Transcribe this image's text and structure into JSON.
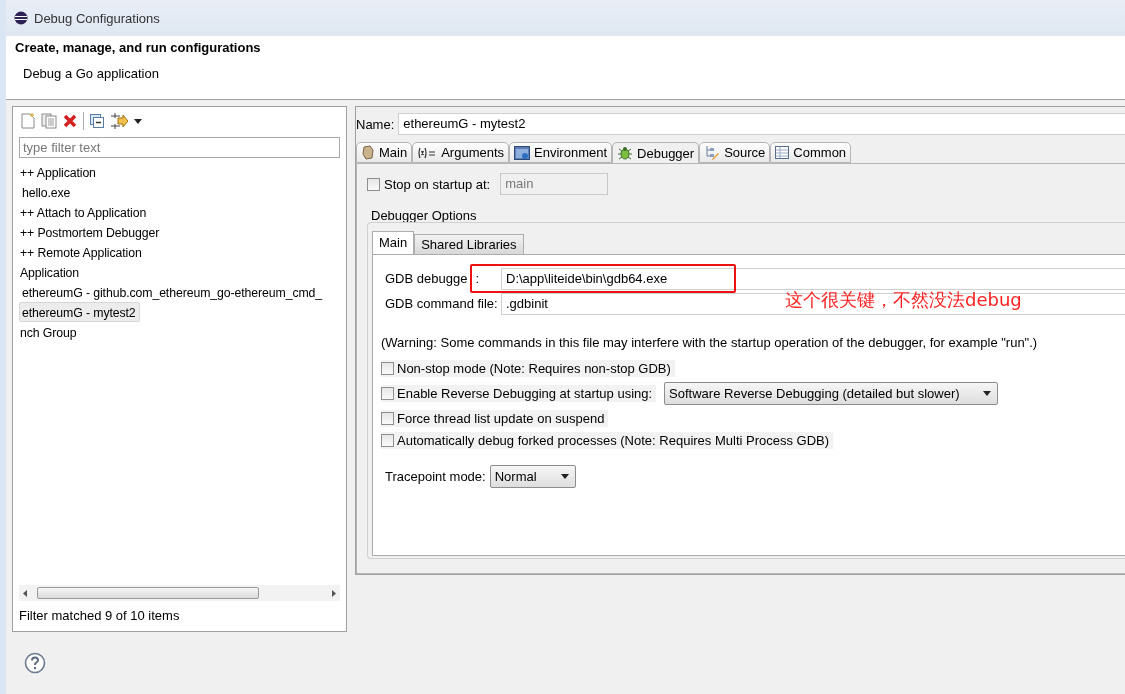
{
  "window": {
    "title": "Debug Configurations"
  },
  "header": {
    "title": "Create, manage, and run configurations",
    "subtitle": "Debug a Go application"
  },
  "filter": {
    "placeholder": "type filter text"
  },
  "tree": [
    {
      "label": "++ Application",
      "selected": false,
      "children": [
        {
          "label": "hello.exe",
          "selected": false
        }
      ]
    },
    {
      "label": "++ Attach to Application",
      "selected": false
    },
    {
      "label": "++ Postmortem Debugger",
      "selected": false
    },
    {
      "label": "++ Remote Application",
      "selected": false
    },
    {
      "label": "Application",
      "selected": false,
      "children": [
        {
          "label": "ethereumG - github.com_ethereum_go-ethereum_cmd_",
          "selected": false
        },
        {
          "label": "ethereumG - mytest2",
          "selected": true
        }
      ]
    },
    {
      "label": "nch Group",
      "selected": false
    }
  ],
  "filter_status": "Filter matched 9 of 10 items",
  "config": {
    "name_label": "Name:",
    "name": "ethereumG - mytest2",
    "tabs": [
      {
        "label": "Main",
        "kind": "main",
        "selected": false
      },
      {
        "label": "Arguments",
        "kind": "arguments",
        "selected": false
      },
      {
        "label": "Environment",
        "kind": "environment",
        "selected": false
      },
      {
        "label": "Debugger",
        "kind": "debugger",
        "selected": true
      },
      {
        "label": "Source",
        "kind": "source",
        "selected": false
      },
      {
        "label": "Common",
        "kind": "common",
        "selected": false
      }
    ],
    "stop_on_startup": {
      "label": "Stop on startup at:",
      "checked": false,
      "value": "main",
      "disabled": true
    },
    "options": {
      "title": "Debugger Options",
      "tabs": [
        {
          "label": "Main",
          "selected": true
        },
        {
          "label": "Shared Libraries",
          "selected": false
        }
      ],
      "gdb_debugger": {
        "label": "GDB debugge",
        "colon": ":",
        "value": "D:\\app\\liteide\\bin\\gdb64.exe"
      },
      "gdb_command_file": {
        "label": "GDB command file:",
        "value": ".gdbinit"
      },
      "warning": "(Warning: Some commands in this file may interfere with the startup operation of the debugger, for example \"run\".)",
      "checkboxes": [
        {
          "label": "Non-stop mode (Note: Requires non-stop GDB)",
          "checked": false
        },
        {
          "label": "Enable Reverse Debugging at startup using:",
          "checked": false,
          "select": "Software Reverse Debugging (detailed but slower)"
        },
        {
          "label": "Force thread list update on suspend",
          "checked": false
        },
        {
          "label": "Automatically debug forked processes (Note: Requires Multi Process GDB)",
          "checked": false
        }
      ],
      "tracepoint": {
        "label": "Tracepoint mode:",
        "value": "Normal"
      }
    }
  },
  "annotation": "这个很关键，不然没法debug"
}
